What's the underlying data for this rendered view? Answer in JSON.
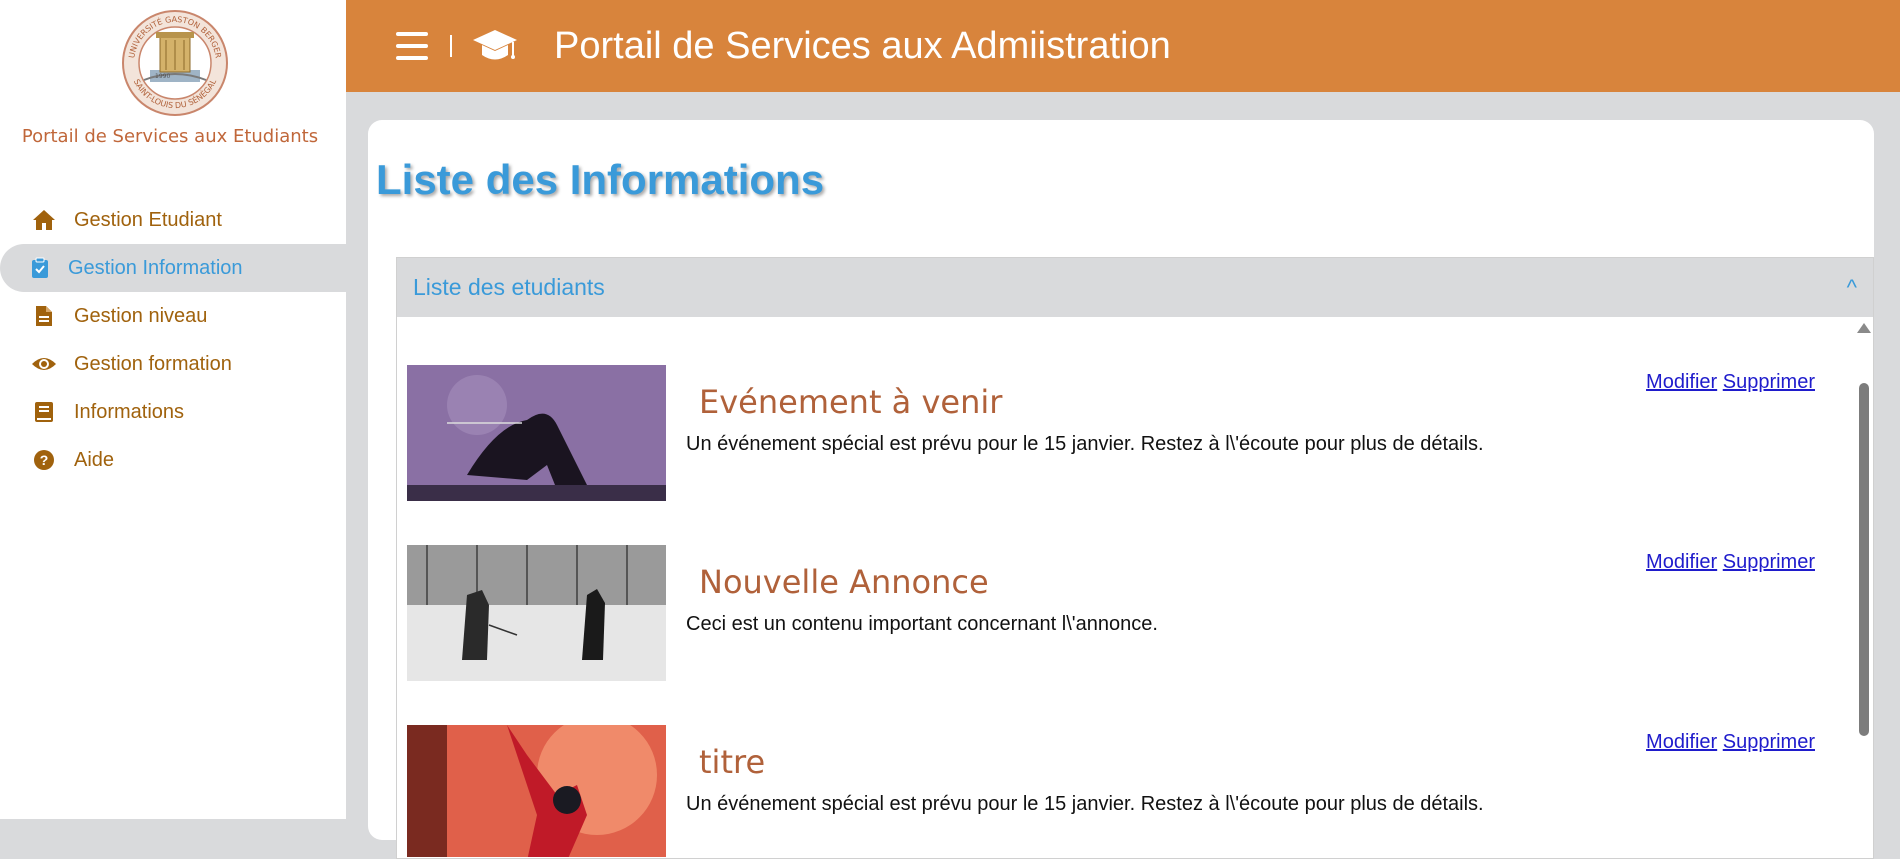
{
  "sidebar": {
    "logo": {
      "top_text": "UNIVERSITÉ GASTON BERGER",
      "bottom_text": "SAINT-LOUIS DU SÉNÉGAL",
      "year": "1990"
    },
    "title": "Portail de Services aux Etudiants",
    "items": [
      {
        "label": "Gestion Etudiant",
        "icon": "home-icon",
        "active": false
      },
      {
        "label": "Gestion Information",
        "icon": "clipboard-icon",
        "active": true
      },
      {
        "label": "Gestion niveau",
        "icon": "document-icon",
        "active": false
      },
      {
        "label": "Gestion formation",
        "icon": "eye-icon",
        "active": false
      },
      {
        "label": "Informations",
        "icon": "book-icon",
        "active": false
      },
      {
        "label": "Aide",
        "icon": "help-icon",
        "active": false
      }
    ]
  },
  "header": {
    "title": "Portail de Services aux Admiistration",
    "icons": [
      "hamburger-icon",
      "graduation-cap-icon"
    ]
  },
  "main": {
    "page_title": "Liste des Informations",
    "panel": {
      "label": "Liste des etudiants",
      "toggle": "^"
    },
    "items": [
      {
        "title": "Evénement à venir",
        "text": "Un événement spécial est prévu pour le 15 janvier. Restez à l\\'écoute pour plus de détails.",
        "edit_label": "Modifier",
        "delete_label": "Supprimer"
      },
      {
        "title": "Nouvelle Annonce",
        "text": "Ceci est un contenu important concernant l\\'annonce.",
        "edit_label": "Modifier",
        "delete_label": "Supprimer"
      },
      {
        "title": "titre",
        "text": "Un événement spécial est prévu pour le 15 janvier. Restez à l\\'écoute pour plus de détails.",
        "edit_label": "Modifier",
        "delete_label": "Supprimer"
      }
    ]
  },
  "colors": {
    "header_bg": "#d8843c",
    "accent_blue": "#3a9ad9",
    "nav_text": "#a0620d",
    "item_title": "#b0613a",
    "link": "#1f1ccc",
    "page_bg": "#d9dadc"
  }
}
